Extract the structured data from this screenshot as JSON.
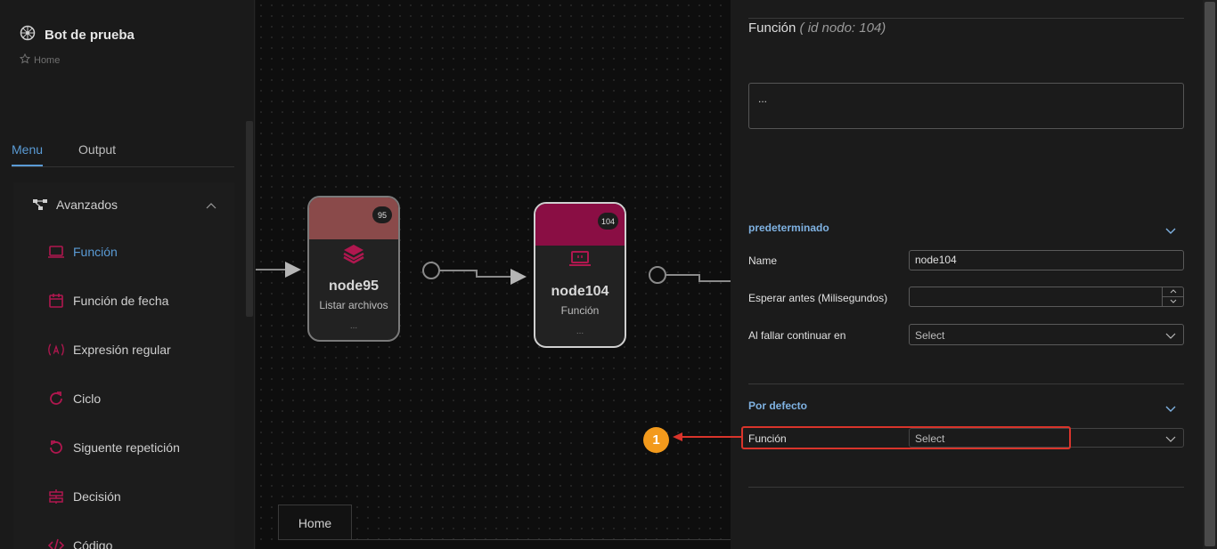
{
  "sidebar": {
    "brand": "Bot de prueba",
    "breadcrumb": "Home",
    "tabs": [
      "Menu",
      "Output"
    ],
    "group": "Avanzados",
    "items": [
      {
        "label": "Función",
        "icon": "laptop-icon"
      },
      {
        "label": "Función de fecha",
        "icon": "calendar-icon"
      },
      {
        "label": "Expresión regular",
        "icon": "regex-icon"
      },
      {
        "label": "Ciclo",
        "icon": "loop-icon"
      },
      {
        "label": "Siguente repetición",
        "icon": "undo-icon"
      },
      {
        "label": "Decisión",
        "icon": "decision-icon"
      },
      {
        "label": "Código",
        "icon": "code-icon"
      }
    ]
  },
  "canvas": {
    "nodes": [
      {
        "badge": "95",
        "title": "node95",
        "subtitle": "Listar archivos",
        "dots": "...",
        "head_color": "#8a4a4a",
        "icon": "layers-icon"
      },
      {
        "badge": "104",
        "title": "node104",
        "subtitle": "Función",
        "dots": "...",
        "head_color": "#8a0e44",
        "icon": "laptop-icon"
      }
    ],
    "home_tab": "Home"
  },
  "panel": {
    "title": "Función",
    "title_id": "( id nodo: 104)",
    "textarea_value": "...",
    "section1": "predeterminado",
    "name_label": "Name",
    "name_value": "node104",
    "wait_label": "Esperar antes (Milisegundos)",
    "wait_value": "",
    "fail_label": "Al fallar continuar en",
    "fail_value": "Select",
    "section2": "Por defecto",
    "func_label": "Función",
    "func_value": "Select"
  },
  "annotation": {
    "number": "1"
  },
  "colors": {
    "accent": "#5a9bd5",
    "icon_red": "#b0174f",
    "callout": "#f39a1c",
    "highlight": "#d9342b"
  }
}
